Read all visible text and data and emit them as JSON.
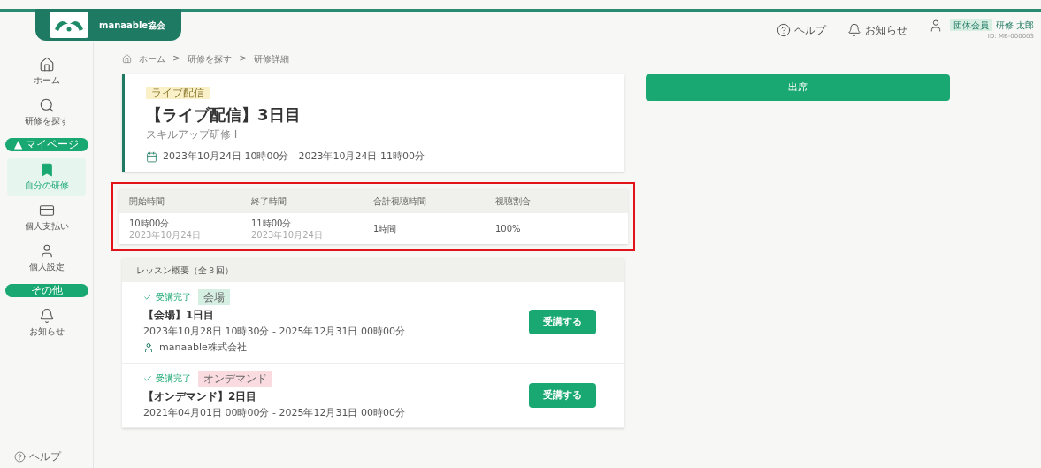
{
  "header": {
    "org_name": "manaable協会",
    "links": [
      {
        "kind": "help",
        "label": "ヘルプ"
      },
      {
        "kind": "bell",
        "label": "お知らせ"
      }
    ],
    "user": {
      "badge": "団体会員",
      "name": "研修 太郎",
      "id": "ID: MB-000003"
    }
  },
  "sidebar": {
    "items": [
      {
        "kind": "home",
        "label": "ホーム",
        "selected": false
      },
      {
        "kind": "search",
        "label": "研修を探す",
        "selected": false
      },
      {
        "kind": "section",
        "label": "▲ マイページ"
      },
      {
        "kind": "bookmark",
        "label": "自分の研修",
        "selected": true
      },
      {
        "kind": "card",
        "label": "個人支払い",
        "selected": false
      },
      {
        "kind": "user",
        "label": "個人設定",
        "selected": false
      },
      {
        "kind": "section",
        "label": "その他"
      },
      {
        "kind": "bell",
        "label": "お知らせ",
        "selected": false
      }
    ],
    "footer": "ヘルプ"
  },
  "breadcrumb": {
    "separator": ">",
    "items": [
      "ホーム",
      "研修を探す",
      "研修詳細"
    ]
  },
  "course": {
    "tag": "ライブ配信",
    "title": "【ライブ配信】3日目",
    "subtitle": "スキルアップ研修 I",
    "date": "2023年10月24日 10時00分 - 2023年10月24日 11時00分"
  },
  "attendance": {
    "columns": [
      "開始時間",
      "終了時間",
      "合計視聴時間",
      "視聴割合"
    ],
    "row": [
      {
        "main": "10時00分",
        "sub": "2023年10月24日"
      },
      {
        "main": "11時00分",
        "sub": "2023年10月24日"
      },
      {
        "main": "1時間"
      },
      {
        "main": "100%"
      }
    ]
  },
  "lessons": {
    "title": "レッスン概要（全３回）",
    "items": [
      {
        "status": "受講完了",
        "tag": "会場",
        "color": "#d5efe3",
        "title": "【会場】1日目",
        "date": "2023年10月28日 10時30分 - 2025年12月31日 00時00分",
        "organizer": "manaable株式会社",
        "button": "受講する"
      },
      {
        "status": "受講完了",
        "tag": "オンデマンド",
        "color": "#fadbe0",
        "title": "【オンデマンド】2日目",
        "date": "2021年04月01日 00時00分 - 2025年12月31日 00時00分",
        "button": "受講する"
      }
    ]
  },
  "attend_button": "出席"
}
